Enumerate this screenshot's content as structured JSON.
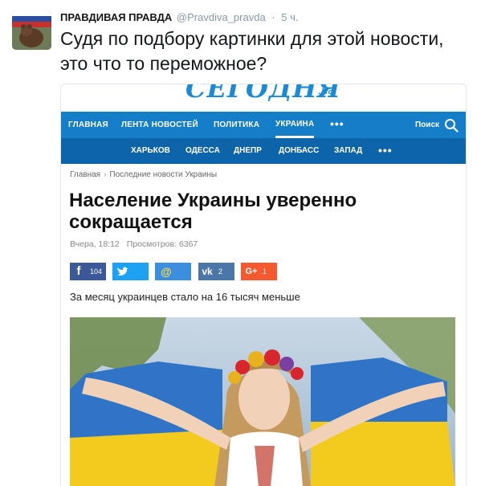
{
  "tweet": {
    "author_name": "ПРАВДИВАЯ ПРАВДА",
    "author_handle": "@Pravdiva_pravda",
    "separator": "·",
    "time": "5 ч.",
    "text": "Судя по подбору картинки для этой новости, это что то переможное?"
  },
  "site": {
    "logo_text": "СЕГОДНЯ",
    "logo_domain": ".ua",
    "brand_color": "#157ec8",
    "subnav_color": "#0e64a8"
  },
  "nav_primary": {
    "items": [
      "ГЛАВНАЯ",
      "ЛЕНТА НОВОСТЕЙ",
      "ПОЛИТИКА",
      "УКРАИНА"
    ],
    "active": "УКРАИНА",
    "more": "•••",
    "search_label": "Поиск"
  },
  "nav_secondary": {
    "items": [
      "ХАРЬКОВ",
      "ОДЕССА",
      "ДНЕПР",
      "ДОНБАСС",
      "ЗАПАД"
    ],
    "more": "•••"
  },
  "breadcrumb": {
    "items": [
      "Главная",
      "Последние новости Украины"
    ],
    "separator": "›"
  },
  "article": {
    "title": "Население Украины уверенно сокращается",
    "date": "Вчера, 18:12",
    "views": "Просмотров: 6367",
    "lead": "За месяц украинцев стало на 16 тысяч меньше"
  },
  "share": {
    "facebook": {
      "icon": "facebook-icon",
      "glyph": "f",
      "count": "104",
      "color": "#3b5998"
    },
    "twitter": {
      "icon": "twitter-icon",
      "glyph": "t",
      "count": "",
      "color": "#1da1f2"
    },
    "mail": {
      "icon": "mail-icon",
      "glyph": "@",
      "count": "",
      "color": "#3c8ede"
    },
    "vk": {
      "icon": "vk-icon",
      "glyph": "vk",
      "count": "2",
      "color": "#4a76a8"
    },
    "gplus": {
      "icon": "google-plus-icon",
      "glyph": "G+",
      "count": "1",
      "color": "#f4592f"
    }
  }
}
